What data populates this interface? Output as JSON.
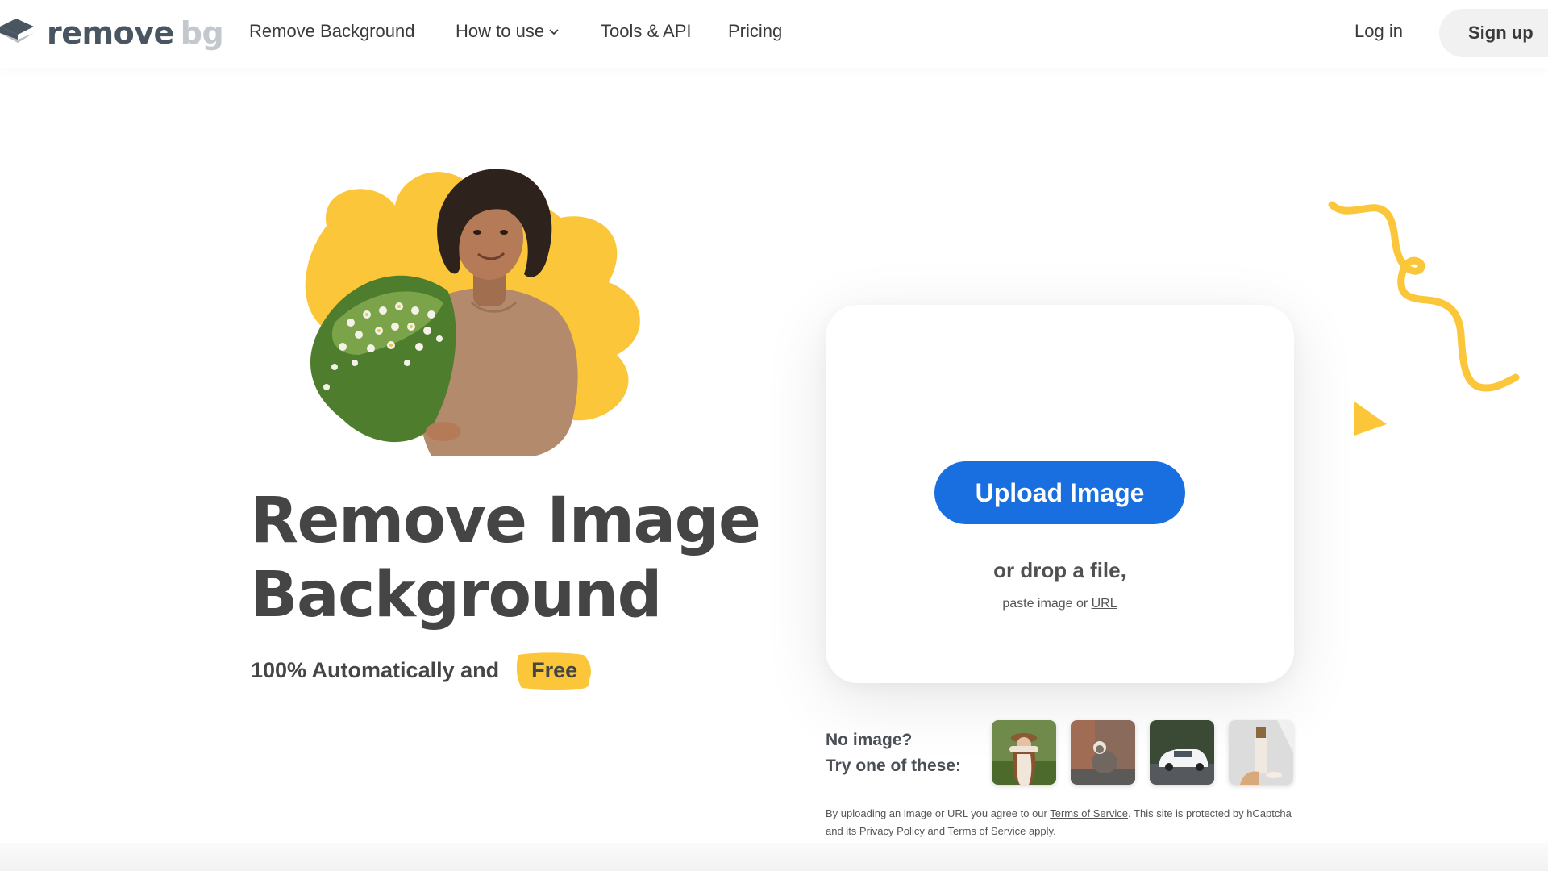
{
  "brand": {
    "name_main": "remove",
    "name_accent": "bg"
  },
  "nav": {
    "items": [
      {
        "label": "Remove Background"
      },
      {
        "label": "How to use",
        "has_dropdown": true
      },
      {
        "label": "Tools & API"
      },
      {
        "label": "Pricing"
      }
    ],
    "login_label": "Log in",
    "signup_label": "Sign up"
  },
  "hero": {
    "headline_line1": "Remove Image",
    "headline_line2": "Background",
    "subline": "100% Automatically and",
    "badge": "Free",
    "image_alt": "Woman holding a bouquet of daisies in front of a yellow shape"
  },
  "upload": {
    "button_label": "Upload Image",
    "drop_text": "or drop a file,",
    "paste_prefix": "paste image or ",
    "paste_link": "URL"
  },
  "samples": {
    "line1": "No image?",
    "line2": "Try one of these:",
    "thumbnails": [
      {
        "alt": "Woman with hat and long hair"
      },
      {
        "alt": "Cat sitting on a ledge"
      },
      {
        "alt": "White car on road"
      },
      {
        "alt": "Cosmetic bottle product"
      }
    ]
  },
  "legal": {
    "part1": "By uploading an image or URL you agree to our ",
    "link1": "Terms of Service",
    "part2": ". This site is protected by hCaptcha and its ",
    "link2": "Privacy Policy",
    "part3": " and ",
    "link3": "Terms of Service",
    "part4": " apply."
  },
  "colors": {
    "accent_blue": "#1a6fe0",
    "accent_yellow": "#fcc63a",
    "text_dark": "#454545"
  }
}
